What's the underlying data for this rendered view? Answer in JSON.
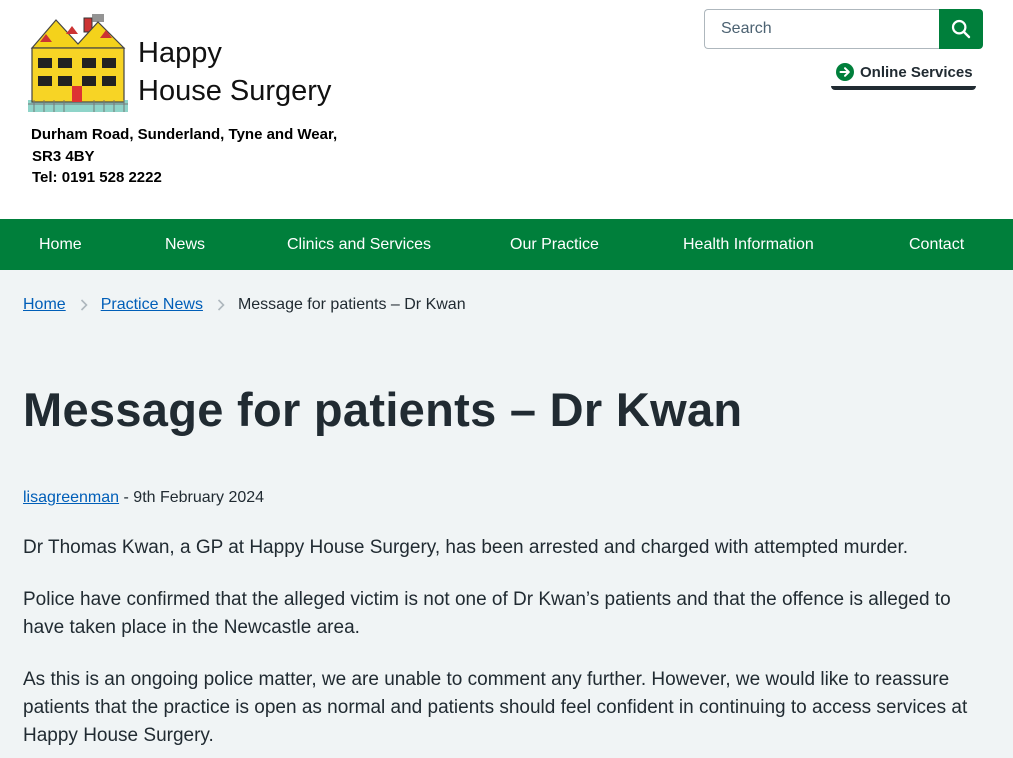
{
  "header": {
    "logo_line1": "Happy",
    "logo_line2": "House Surgery",
    "address_line1": "Durham Road, Sunderland, Tyne and Wear,",
    "address_line2": "SR3 4BY",
    "address_line3": "Tel: 0191 528 2222"
  },
  "search": {
    "placeholder": "Search"
  },
  "online_services": {
    "label": "Online Services"
  },
  "nav": {
    "items": [
      {
        "label": "Home"
      },
      {
        "label": "News"
      },
      {
        "label": "Clinics and Services"
      },
      {
        "label": "Our Practice"
      },
      {
        "label": "Health Information"
      },
      {
        "label": "Contact"
      }
    ]
  },
  "breadcrumb": {
    "home": "Home",
    "parent": "Practice News",
    "current": "Message for patients – Dr Kwan"
  },
  "article": {
    "title": "Message for patients – Dr Kwan",
    "author": "lisagreenman",
    "date": "- 9th February 2024",
    "paragraphs": [
      "Dr Thomas Kwan, a GP at Happy House Surgery, has been arrested and charged with attempted murder.",
      "Police have confirmed that the alleged victim is not one of Dr Kwan’s patients and that the offence is alleged to have taken place in the Newcastle area.",
      "As this is an ongoing police matter, we are unable to comment any further. However, we would like to reassure patients that the practice is open as normal and patients should feel confident in continuing to access services at Happy House Surgery."
    ]
  },
  "colors": {
    "nhs_green": "#007f3b",
    "link_blue": "#005eb8",
    "text": "#212b32",
    "page_bg": "#f0f4f5"
  }
}
